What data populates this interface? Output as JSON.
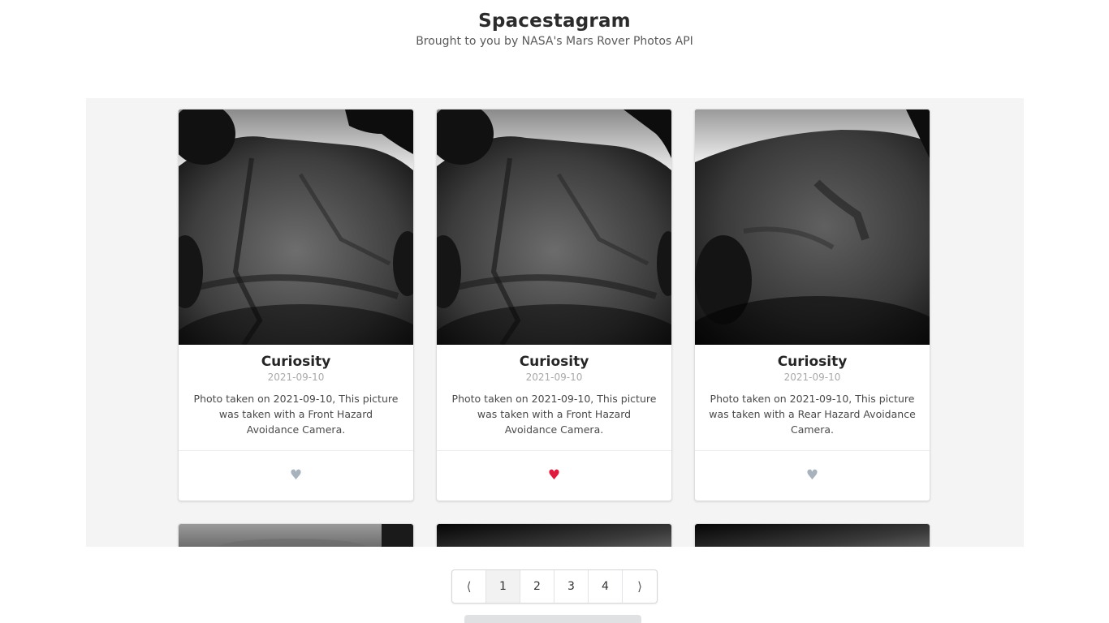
{
  "header": {
    "title": "Spacestagram",
    "subtitle": "Brought to you by NASA's Mars Rover Photos API"
  },
  "cards": [
    {
      "rover": "Curiosity",
      "date": "2021-09-10",
      "description": "Photo taken on 2021-09-10, This picture was taken with a Front Hazard Avoidance Camera.",
      "liked": false,
      "image_alt": "Mars surface photo from front hazard camera"
    },
    {
      "rover": "Curiosity",
      "date": "2021-09-10",
      "description": "Photo taken on 2021-09-10, This picture was taken with a Front Hazard Avoidance Camera.",
      "liked": true,
      "image_alt": "Mars surface photo from front hazard camera"
    },
    {
      "rover": "Curiosity",
      "date": "2021-09-10",
      "description": "Photo taken on 2021-09-10, This picture was taken with a Rear Hazard Avoidance Camera.",
      "liked": false,
      "image_alt": "Mars surface photo from rear hazard camera"
    }
  ],
  "icons": {
    "like": "heart-icon",
    "prev": "chevron-left-icon",
    "next": "chevron-right-icon"
  },
  "colors": {
    "heart_liked": "#e0193e",
    "heart_unliked": "#a7b2bd",
    "feed_background": "#f4f4f4"
  },
  "pagination": {
    "prev_label": "⟨",
    "next_label": "⟩",
    "pages": [
      "1",
      "2",
      "3",
      "4"
    ],
    "active_page": "1"
  }
}
